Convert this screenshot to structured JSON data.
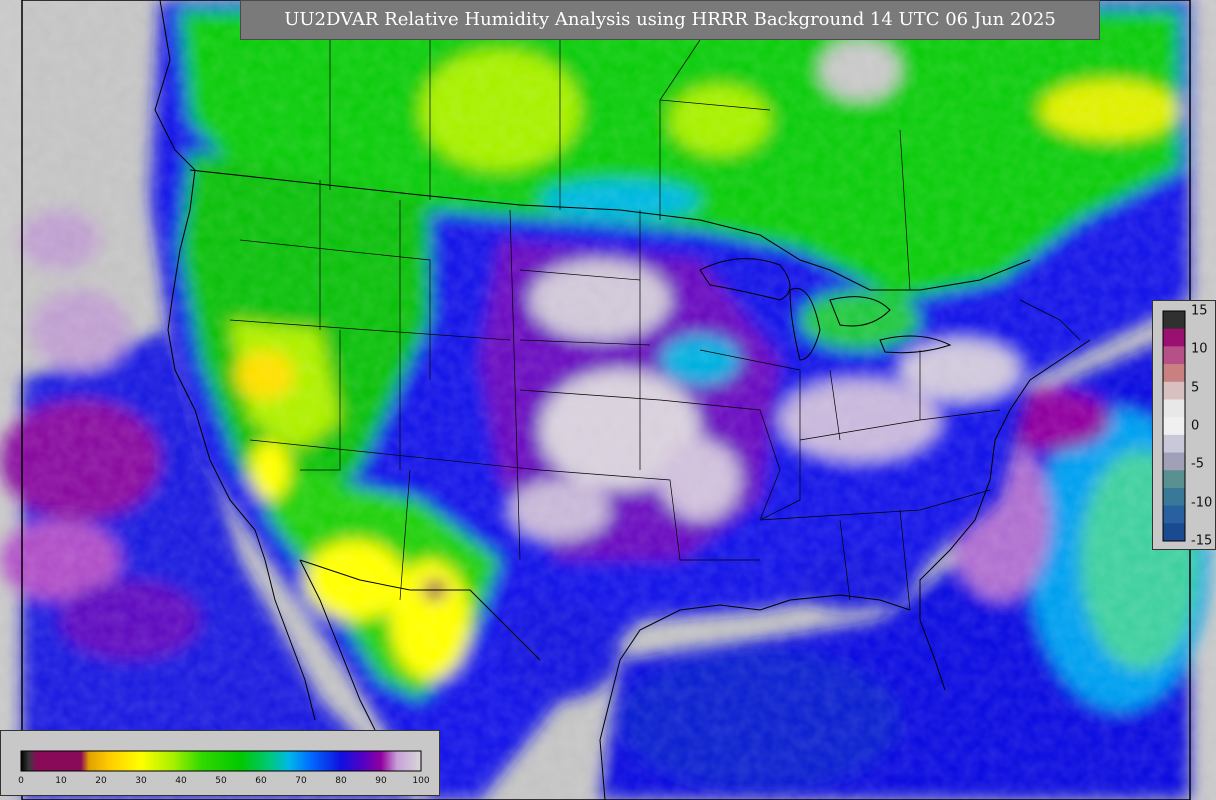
{
  "title": "UU2DVAR Relative Humidity Analysis using HRRR Background 14 UTC 06 Jun 2025",
  "colorbar_bottom": {
    "labels": [
      "0",
      "10",
      "20",
      "30",
      "40",
      "50",
      "60",
      "70",
      "80",
      "90",
      "100"
    ],
    "stops": [
      {
        "v": 0,
        "c": "#000000"
      },
      {
        "v": 2,
        "c": "#3a3a3a"
      },
      {
        "v": 4,
        "c": "#8a0a5a"
      },
      {
        "v": 15,
        "c": "#8a0a5a"
      },
      {
        "v": 17,
        "c": "#e0a000"
      },
      {
        "v": 22,
        "c": "#ffcc00"
      },
      {
        "v": 30,
        "c": "#ffff00"
      },
      {
        "v": 38,
        "c": "#a8f000"
      },
      {
        "v": 45,
        "c": "#33d900"
      },
      {
        "v": 55,
        "c": "#00c800"
      },
      {
        "v": 62,
        "c": "#00c878"
      },
      {
        "v": 67,
        "c": "#00b8e8"
      },
      {
        "v": 72,
        "c": "#0070ff"
      },
      {
        "v": 80,
        "c": "#1010e0"
      },
      {
        "v": 86,
        "c": "#5a00c0"
      },
      {
        "v": 90,
        "c": "#9000a0"
      },
      {
        "v": 94,
        "c": "#c8a0d8"
      },
      {
        "v": 100,
        "c": "#d8d8d8"
      }
    ]
  },
  "colorbar_right": {
    "labels": [
      "15",
      "10",
      "5",
      "0",
      "-5",
      "-10",
      "-15"
    ],
    "colors": [
      "#303030",
      "#9a1070",
      "#b85088",
      "#c88080",
      "#d8c0c0",
      "#e8e8e8",
      "#f0f0f0",
      "#c8c8d8",
      "#a0a0b8",
      "#5a9090",
      "#3a7898",
      "#2860a0",
      "#1a4a90"
    ]
  },
  "map": {
    "colors": {
      "ocean_grey": "#c8c8c8",
      "purple": "#8a0aa0",
      "blue": "#1010e0",
      "cyan": "#00b0f0",
      "green": "#10cc10",
      "lime": "#90ee00",
      "yellow": "#ffff00",
      "orange": "#ffc000",
      "border": "#000000"
    }
  }
}
